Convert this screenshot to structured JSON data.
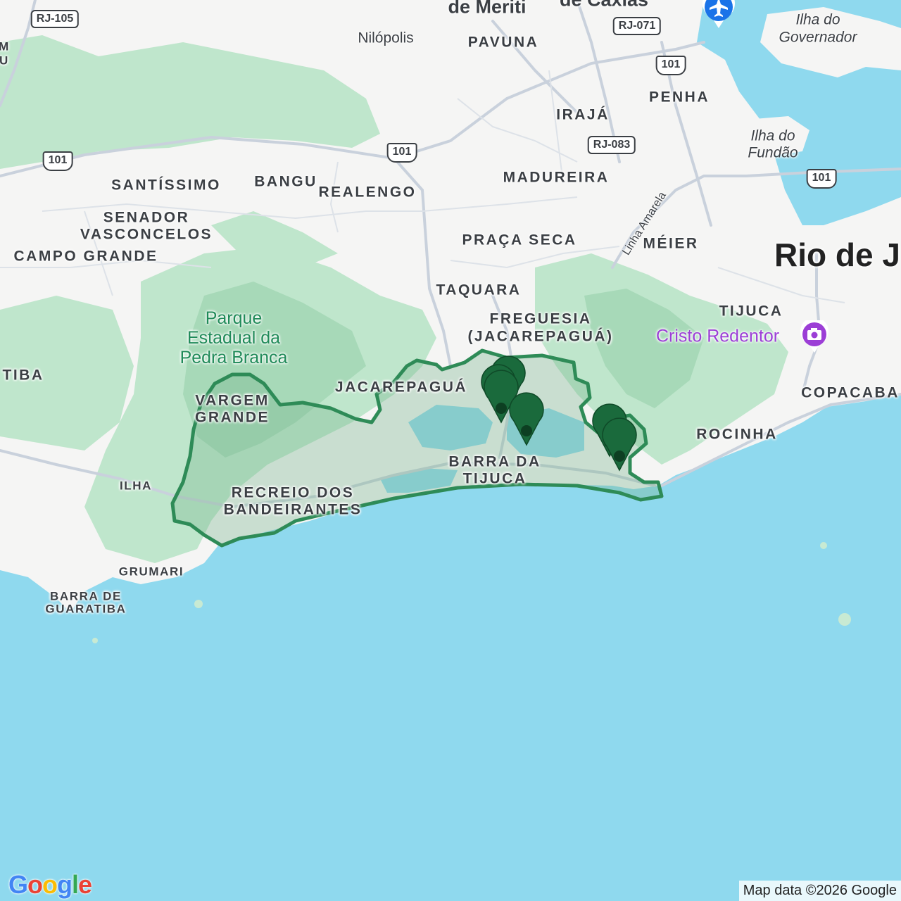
{
  "labels": {
    "neighborhoods": [
      {
        "text": "SANTÍSSIMO"
      },
      {
        "text": "BANGU"
      },
      {
        "text": "REALENGO"
      },
      {
        "text": "MADUREIRA"
      },
      {
        "text": "SENADOR"
      },
      {
        "text": "VASCONCELOS"
      },
      {
        "text": "CAMPO GRANDE"
      },
      {
        "text": "PRAÇA SECA"
      },
      {
        "text": "MÉIER"
      },
      {
        "text": "TAQUARA"
      },
      {
        "text": "FREGUESIA"
      },
      {
        "text": "(JACAREPAGUÁ)"
      },
      {
        "text": "TIJUCA"
      },
      {
        "text": "JACAREPAGUÁ"
      },
      {
        "text": "VARGEM"
      },
      {
        "text": "GRANDE"
      },
      {
        "text": "COPACABA"
      },
      {
        "text": "ROCINHA"
      },
      {
        "text": "BARRA DA"
      },
      {
        "text": "TIJUCA"
      },
      {
        "text": "ILHA"
      },
      {
        "text": "RECREIO DOS"
      },
      {
        "text": "BANDEIRANTES"
      },
      {
        "text": "GRUMARI"
      },
      {
        "text": "BARRA DE"
      },
      {
        "text": "GUARATIBA"
      },
      {
        "text": "PAVUNA"
      },
      {
        "text": "IRAJÁ"
      },
      {
        "text": "PENHA"
      },
      {
        "text": "TIBA"
      },
      {
        "text": "M"
      },
      {
        "text": "U"
      }
    ],
    "cities": [
      {
        "text": "Nilópolis"
      },
      {
        "text": "de Meriti"
      },
      {
        "text": "de Caxias"
      },
      {
        "text": "Ilha do"
      },
      {
        "text": "Governador"
      },
      {
        "text": "Ilha do"
      },
      {
        "text": "Fundão"
      },
      {
        "text": "Linha Amarela"
      }
    ],
    "major_city": "Rio de J",
    "park": "Parque\nEstadual da\nPedra Branca",
    "poi": "Cristo Redentor"
  },
  "road_shields": [
    {
      "text": "RJ-105"
    },
    {
      "text": "RJ-071"
    },
    {
      "text": "101"
    },
    {
      "text": "101"
    },
    {
      "text": "101"
    },
    {
      "text": "RJ-083"
    },
    {
      "text": "101"
    }
  ],
  "markers_count": 6,
  "colors": {
    "water": "#8fd9ee",
    "land": "#f5f5f4",
    "park": "#bfe6cc",
    "region_fill": "#9ccba8",
    "region_stroke": "#2e8b57",
    "marker": "#1a6a3c",
    "road": "#c9d1dc",
    "poi": "#9c3ed6"
  },
  "logo": "Google",
  "attribution": "Map data ©2026 Google"
}
